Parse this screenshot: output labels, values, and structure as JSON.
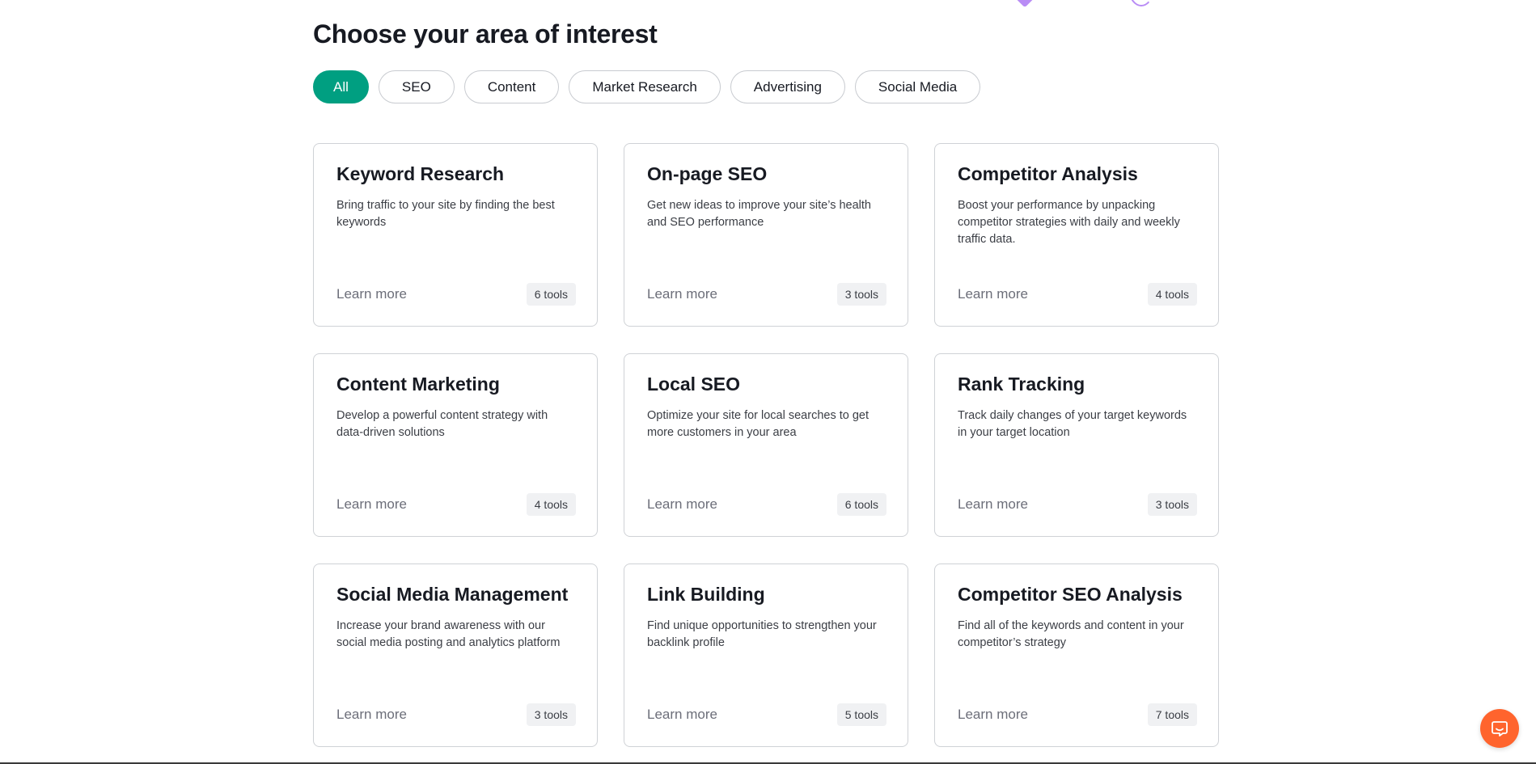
{
  "header": {
    "title": "Choose your area of interest"
  },
  "filters": [
    {
      "label": "All",
      "active": true
    },
    {
      "label": "SEO",
      "active": false
    },
    {
      "label": "Content",
      "active": false
    },
    {
      "label": "Market Research",
      "active": false
    },
    {
      "label": "Advertising",
      "active": false
    },
    {
      "label": "Social Media",
      "active": false
    }
  ],
  "cards": [
    {
      "title": "Keyword Research",
      "description": "Bring traffic to your site by finding the best keywords",
      "link": "Learn more",
      "tools": "6 tools"
    },
    {
      "title": "On-page SEO",
      "description": "Get new ideas to improve your site’s health and SEO performance",
      "link": "Learn more",
      "tools": "3 tools"
    },
    {
      "title": "Competitor Analysis",
      "description": "Boost your performance by unpacking competitor strategies with daily and weekly traffic data.",
      "link": "Learn more",
      "tools": "4 tools"
    },
    {
      "title": "Content Marketing",
      "description": "Develop a powerful content strategy with data-driven solutions",
      "link": "Learn more",
      "tools": "4 tools"
    },
    {
      "title": "Local SEO",
      "description": "Optimize your site for local searches to get more customers in your area",
      "link": "Learn more",
      "tools": "6 tools"
    },
    {
      "title": "Rank Tracking",
      "description": "Track daily changes of your target keywords in your target location",
      "link": "Learn more",
      "tools": "3 tools"
    },
    {
      "title": "Social Media Management",
      "description": "Increase your brand awareness with our social media posting and analytics platform",
      "link": "Learn more",
      "tools": "3 tools"
    },
    {
      "title": "Link Building",
      "description": "Find unique opportunities to strengthen your backlink profile",
      "link": "Learn more",
      "tools": "5 tools"
    },
    {
      "title": "Competitor SEO Analysis",
      "description": "Find all of the keywords and content in your competitor’s strategy",
      "link": "Learn more",
      "tools": "7 tools"
    }
  ],
  "colors": {
    "accent": "#009f81",
    "chat": "#ff642d",
    "decoration": "#b98cf5"
  },
  "icons": {
    "chat": "chat-bubble-icon"
  }
}
